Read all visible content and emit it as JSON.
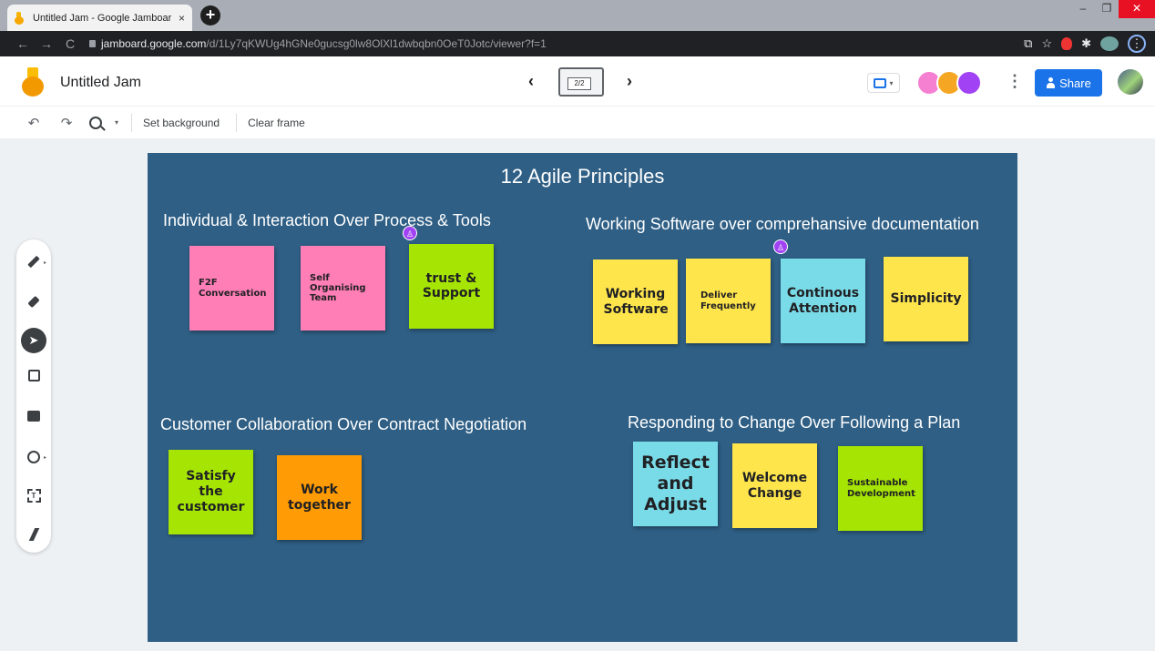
{
  "browser": {
    "tab_title": "Untitled Jam - Google Jamboard",
    "tab_close": "×",
    "new_tab": "+",
    "url_host": "jamboard.google.com",
    "url_path": "/d/1Ly7qKWUg4hGNe0gucsg0lw8OlXl1dwbqbn0OeT0Jotc/viewer?f=1",
    "window_controls": [
      "–",
      "❐",
      "✕"
    ]
  },
  "app": {
    "title": "Untitled Jam",
    "frame_indicator": "2/2",
    "prev": "‹",
    "next": "›",
    "share_label": "Share",
    "more": "⋮"
  },
  "toolbar": {
    "undo": "↶",
    "redo": "↷",
    "set_background": "Set background",
    "clear_frame": "Clear frame"
  },
  "jam": {
    "title": "12 Agile  Principles",
    "sections": [
      {
        "heading": "Individual & Interaction Over Process & Tools"
      },
      {
        "heading": "Working Software over comprehansive documentation"
      },
      {
        "heading": "Customer Collaboration Over Contract Negotiation"
      },
      {
        "heading": "Responding to Change Over Following a Plan"
      }
    ],
    "notes": [
      {
        "text": "F2F Conversation",
        "color": "#ff7eb6"
      },
      {
        "text": "Self Organising Team",
        "color": "#ff7eb6"
      },
      {
        "text": "trust & Support",
        "color": "#a6e404"
      },
      {
        "text": "Working Software",
        "color": "#ffe54c"
      },
      {
        "text": "Deliver Frequently",
        "color": "#ffe54c"
      },
      {
        "text": "Continous Attention",
        "color": "#7adbe8"
      },
      {
        "text": "Simplicity",
        "color": "#ffe54c"
      },
      {
        "text": "Satisfy the customer",
        "color": "#a6e404"
      },
      {
        "text": "Work together",
        "color": "#ff9b04"
      },
      {
        "text": "Reflect and Adjust",
        "color": "#7adbe8"
      },
      {
        "text": "Welcome Change",
        "color": "#ffe54c"
      },
      {
        "text": "Sustainable Development",
        "color": "#a6e404"
      }
    ]
  },
  "icons": {
    "tools": [
      "pen-icon",
      "eraser-icon",
      "select-icon",
      "sticky-note-icon",
      "image-icon",
      "circle-icon",
      "text-box-icon",
      "laser-icon"
    ]
  }
}
